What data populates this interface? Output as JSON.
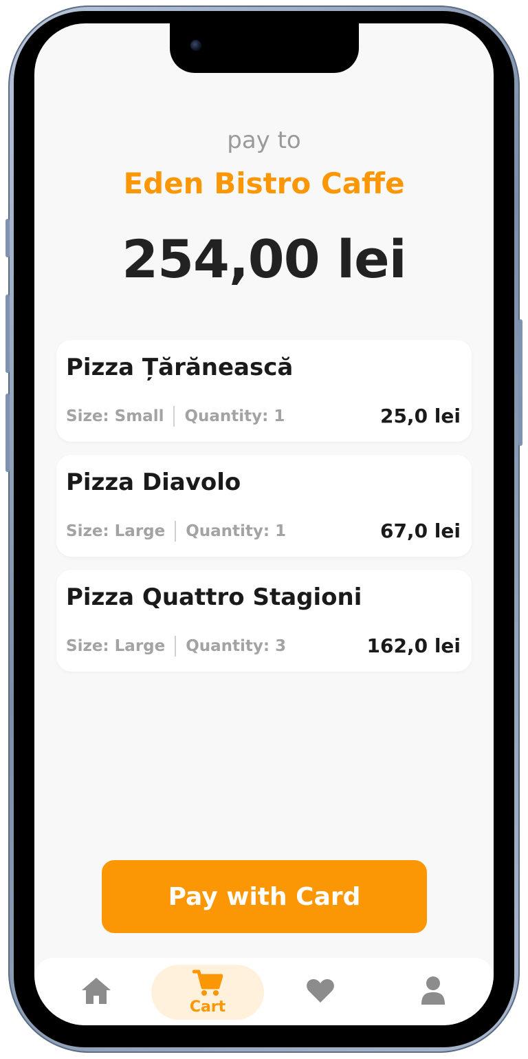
{
  "header": {
    "pay_to_label": "pay to",
    "merchant_name": "Eden Bistro Caffe",
    "total_amount": "254,00 lei"
  },
  "cart_items": [
    {
      "name": "Pizza Țărănească",
      "size": "Size: Small",
      "quantity": "Quantity: 1",
      "price": "25,0 lei"
    },
    {
      "name": "Pizza Diavolo",
      "size": "Size: Large",
      "quantity": "Quantity: 1",
      "price": "67,0 lei"
    },
    {
      "name": "Pizza Quattro Stagioni",
      "size": "Size: Large",
      "quantity": "Quantity: 3",
      "price": "162,0 lei"
    }
  ],
  "actions": {
    "pay_button_label": "Pay with Card"
  },
  "bottom_nav": {
    "items": [
      {
        "icon": "home-icon",
        "label": ""
      },
      {
        "icon": "cart-icon",
        "label": "Cart",
        "active": true
      },
      {
        "icon": "heart-icon",
        "label": ""
      },
      {
        "icon": "user-icon",
        "label": ""
      }
    ]
  },
  "colors": {
    "accent": "#fb9604",
    "active_tab_bg": "#fff1db",
    "text_primary": "#1a1a1a",
    "text_muted": "#a3a3a3",
    "screen_bg": "#f8f8f8"
  }
}
